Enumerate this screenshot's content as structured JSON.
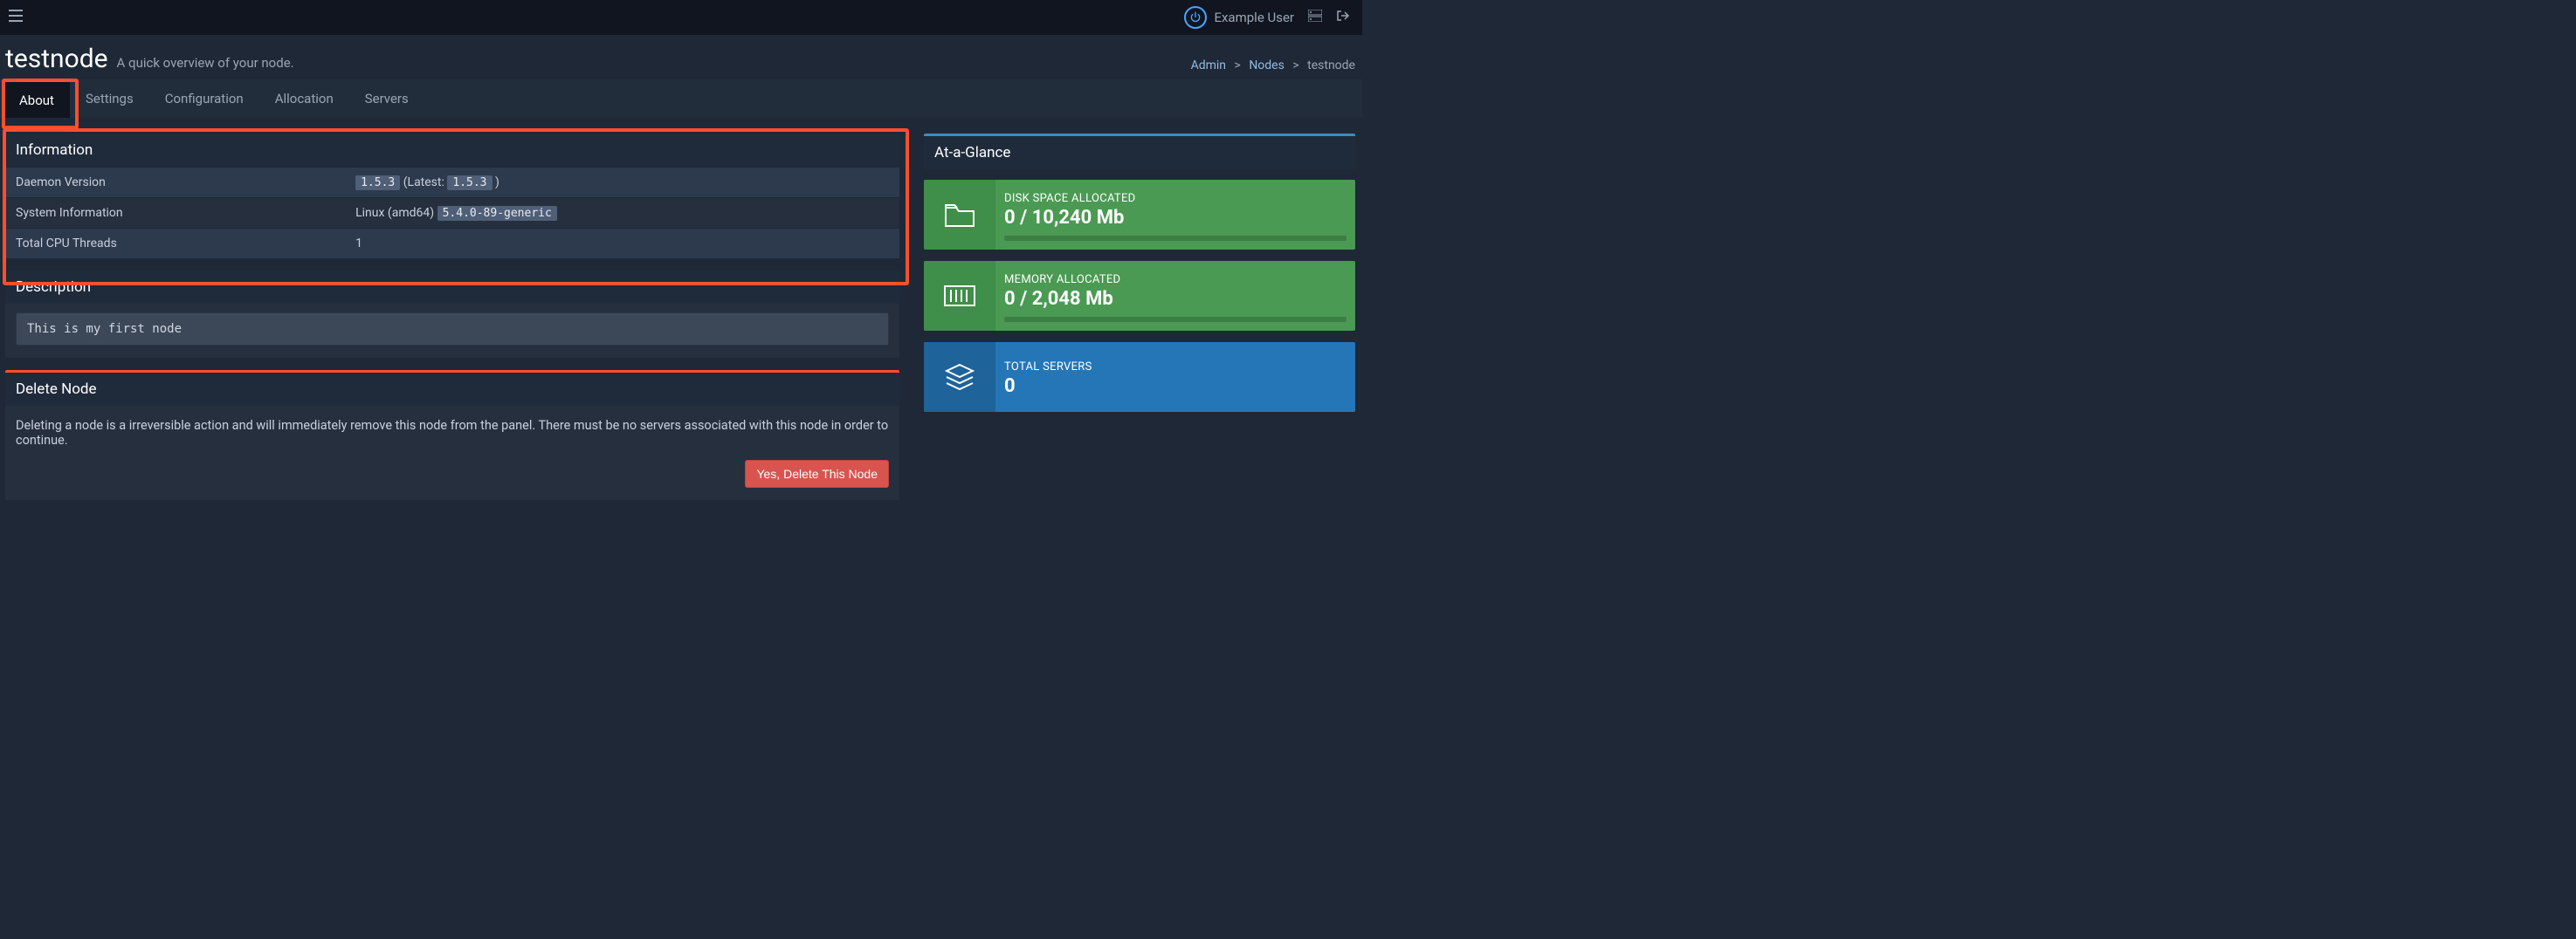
{
  "navbar": {
    "username": "Example User"
  },
  "header": {
    "title": "testnode",
    "subtitle": "A quick overview of your node."
  },
  "breadcrumb": {
    "admin": "Admin",
    "nodes": "Nodes",
    "active": "testnode",
    "sep": ">"
  },
  "tabs": {
    "about": "About",
    "settings": "Settings",
    "configuration": "Configuration",
    "allocation": "Allocation",
    "servers": "Servers"
  },
  "information": {
    "panel_title": "Information",
    "rows": {
      "daemon_version_label": "Daemon Version",
      "daemon_version_value": "1.5.3",
      "daemon_version_middle": " (Latest: ",
      "daemon_version_latest": "1.5.3",
      "daemon_version_after": " )",
      "system_info_label": "System Information",
      "system_info_os": "Linux (amd64) ",
      "system_info_kernel": "5.4.0-89-generic",
      "cpu_label": "Total CPU Threads",
      "cpu_value": "1"
    }
  },
  "description": {
    "title": "Description",
    "text": "This is my first node"
  },
  "delete": {
    "title": "Delete Node",
    "text": "Deleting a node is a irreversible action and will immediately remove this node from the panel. There must be no servers associated with this node in order to continue.",
    "button": "Yes, Delete This Node"
  },
  "glance": {
    "title": "At-a-Glance",
    "disk": {
      "label": "DISK SPACE ALLOCATED",
      "value": "0 / 10,240 Mb"
    },
    "memory": {
      "label": "MEMORY ALLOCATED",
      "value": "0 / 2,048 Mb"
    },
    "servers": {
      "label": "TOTAL SERVERS",
      "value": "0"
    }
  }
}
